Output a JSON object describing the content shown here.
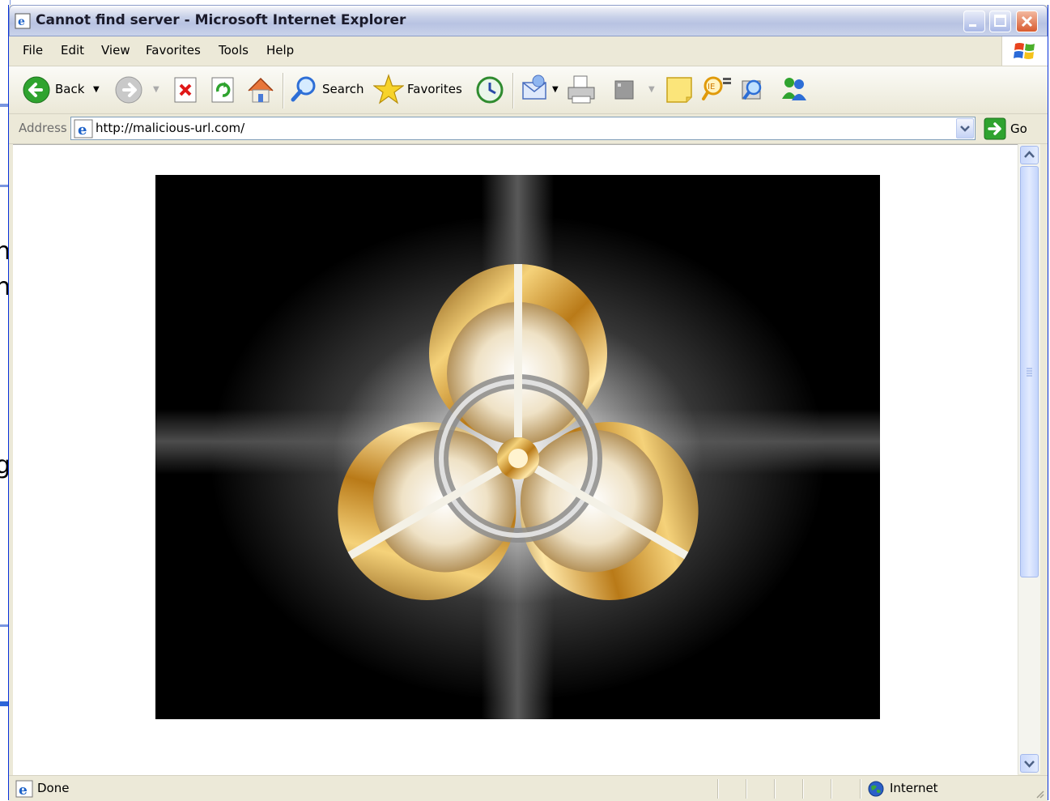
{
  "window": {
    "title": "Cannot find server - Microsoft Internet Explorer"
  },
  "menu": {
    "items": [
      {
        "label": "File"
      },
      {
        "label": "Edit"
      },
      {
        "label": "View"
      },
      {
        "label": "Favorites"
      },
      {
        "label": "Tools"
      },
      {
        "label": "Help"
      }
    ]
  },
  "toolbar": {
    "back_label": "Back",
    "search_label": "Search",
    "favorites_label": "Favorites"
  },
  "address": {
    "label": "Address",
    "url": "http://malicious-url.com/",
    "go_label": "Go"
  },
  "page": {
    "image_icon": "biohazard-icon"
  },
  "status": {
    "text": "Done",
    "zone": "Internet"
  },
  "colors": {
    "titlebar_inactive": "#c6cfe8",
    "chrome": "#ece9d8",
    "gold": "#c9932a",
    "go_green": "#2fa32f"
  }
}
